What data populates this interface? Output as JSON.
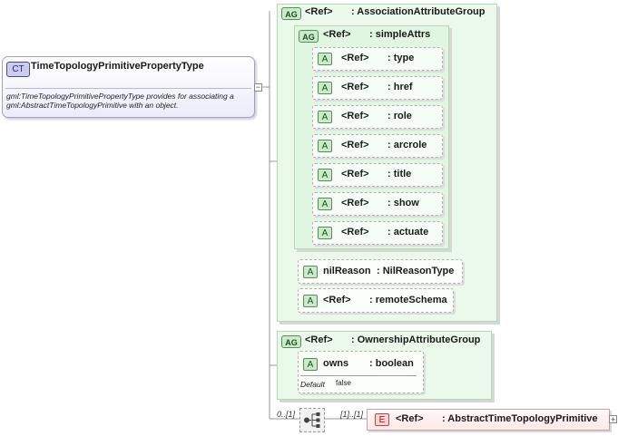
{
  "complex_type": {
    "badge": "CT",
    "name": "TimeTopologyPrimitivePropertyType",
    "documentation": "gml:TimeTopologyPrimitivePropertyType provides for associating a gml:AbstractTimeTopologyPrimitive with an object."
  },
  "association_group": {
    "badge": "AG",
    "ref": "<Ref>",
    "type": ": AssociationAttributeGroup",
    "simple_attrs": {
      "badge": "AG",
      "ref": "<Ref>",
      "type": ": simpleAttrs",
      "attributes": [
        {
          "badge": "A",
          "ref": "<Ref>",
          "name": ": type"
        },
        {
          "badge": "A",
          "ref": "<Ref>",
          "name": ": href"
        },
        {
          "badge": "A",
          "ref": "<Ref>",
          "name": ": role"
        },
        {
          "badge": "A",
          "ref": "<Ref>",
          "name": ": arcrole"
        },
        {
          "badge": "A",
          "ref": "<Ref>",
          "name": ": title"
        },
        {
          "badge": "A",
          "ref": "<Ref>",
          "name": ": show"
        },
        {
          "badge": "A",
          "ref": "<Ref>",
          "name": ": actuate"
        }
      ]
    },
    "nil_reason": {
      "badge": "A",
      "name": "nilReason",
      "type": ": NilReasonType"
    },
    "remote_schema": {
      "badge": "A",
      "ref": "<Ref>",
      "name": ": remoteSchema"
    }
  },
  "ownership_group": {
    "badge": "AG",
    "ref": "<Ref>",
    "type": ": OwnershipAttributeGroup",
    "owns": {
      "badge": "A",
      "name": "owns",
      "type": ": boolean",
      "default_label": "Default",
      "default_value": "false"
    }
  },
  "sequence": {
    "occurrence": "0..[1]",
    "child_occurrence": "[1]..[1]"
  },
  "element": {
    "badge": "E",
    "ref": "<Ref>",
    "type": ": AbstractTimeTopologyPrimitive"
  }
}
